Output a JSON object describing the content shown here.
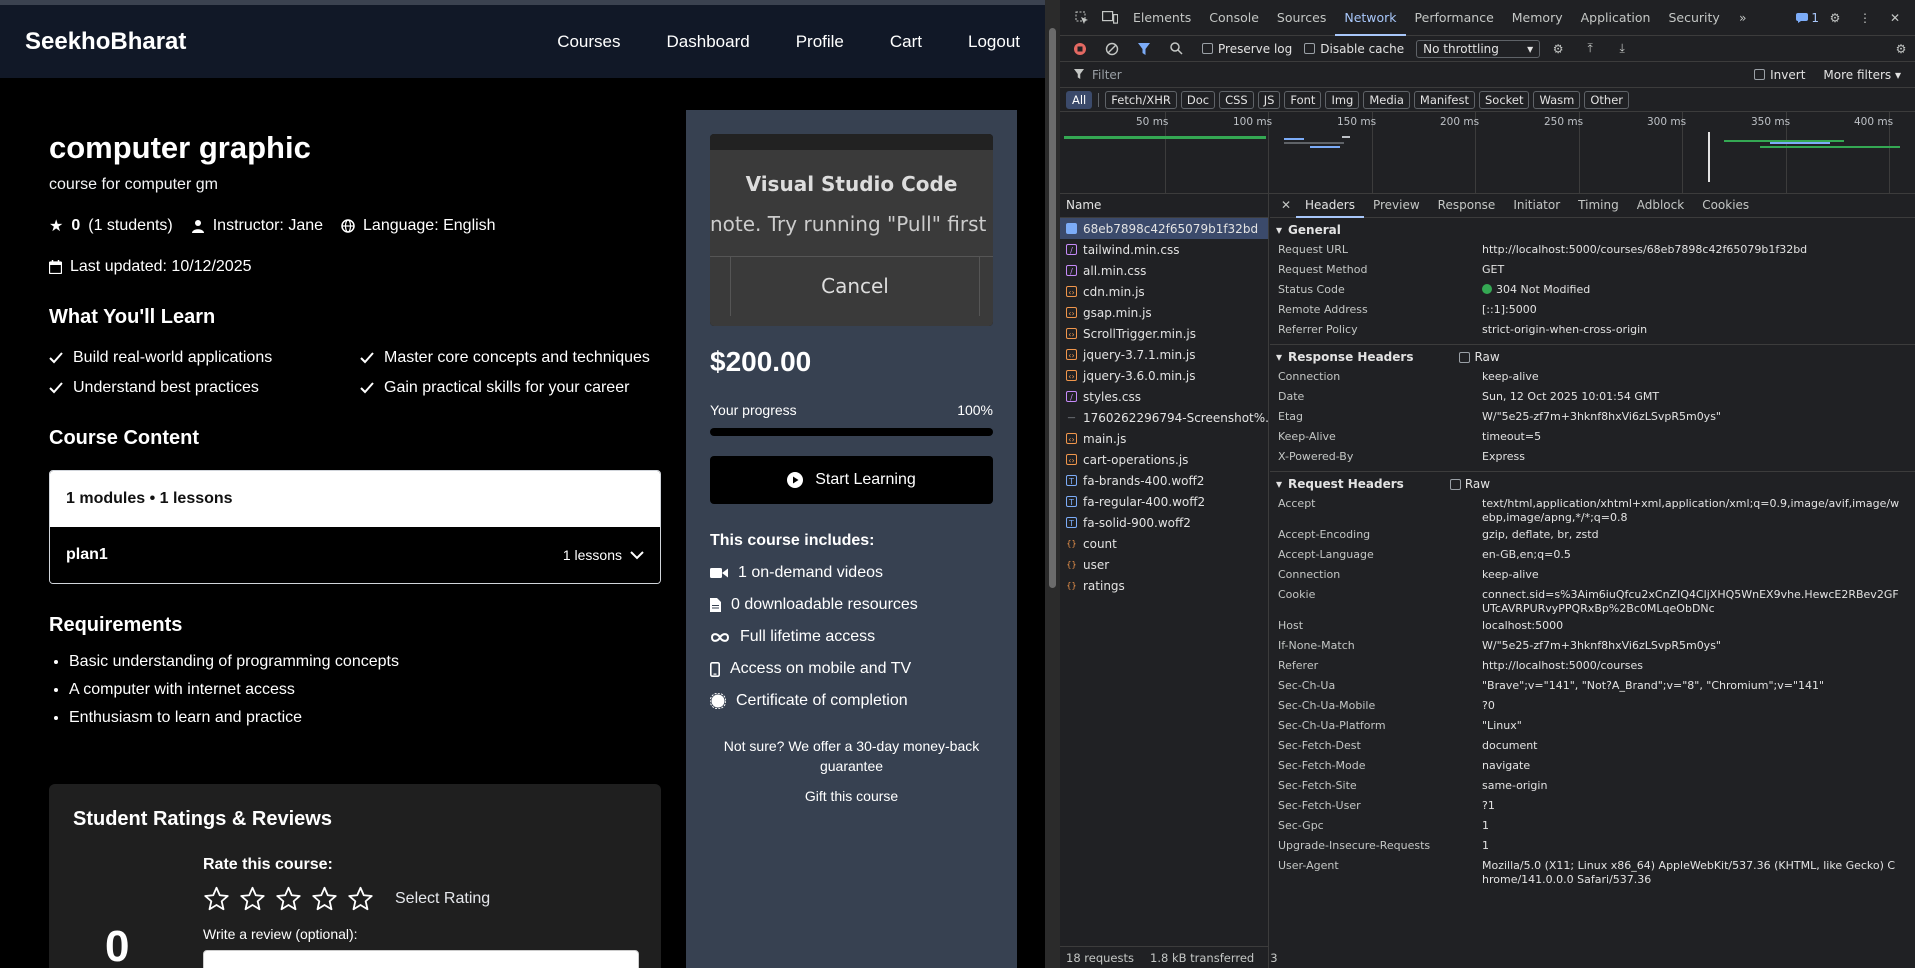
{
  "site": {
    "brand": "SeekhoBharat",
    "nav": [
      "Courses",
      "Dashboard",
      "Profile",
      "Cart",
      "Logout"
    ],
    "course": {
      "title": "computer graphic",
      "subtitle": "course for computer gm",
      "rating": "0",
      "students": "(1 students)",
      "instructor": "Instructor: Jane",
      "language": "Language: English",
      "last_updated": "Last updated: 10/12/2025"
    },
    "learn": {
      "heading": "What You'll Learn",
      "items": [
        "Build real-world applications",
        "Master core concepts and techniques",
        "Understand best practices",
        "Gain practical skills for your career"
      ]
    },
    "content": {
      "heading": "Course Content",
      "summary": "1 modules • 1 lessons",
      "module_name": "plan1",
      "module_lessons": "1 lessons"
    },
    "requirements": {
      "heading": "Requirements",
      "items": [
        "Basic understanding of programming concepts",
        "A computer with internet access",
        "Enthusiasm to learn and practice"
      ]
    },
    "reviews": {
      "heading": "Student Ratings & Reviews",
      "average": "0",
      "rate_title": "Rate this course:",
      "select_rating": "Select Rating",
      "write_label": "Write a review (optional):"
    },
    "sidebar": {
      "preview": {
        "title": "Visual Studio Code",
        "message": "note. Try running \"Pull\" first to in",
        "cancel": "Cancel"
      },
      "price": "$200.00",
      "progress_label": "Your progress",
      "progress_text": "100%",
      "progress_value": 1.0,
      "start_label": "Start Learning",
      "includes_title": "This course includes:",
      "includes": [
        "1 on-demand videos",
        "0 downloadable resources",
        "Full lifetime access",
        "Access on mobile and TV",
        "Certificate of completion"
      ],
      "money_back": "Not sure? We offer a 30-day money-back guarantee",
      "gift": "Gift this course"
    }
  },
  "devtools": {
    "tabs": [
      "Elements",
      "Console",
      "Sources",
      "Network",
      "Performance",
      "Memory",
      "Application",
      "Security"
    ],
    "active_tab": "Network",
    "issues_badge": "1",
    "toolbar": {
      "preserve_log": "Preserve log",
      "disable_cache": "Disable cache",
      "throttling": "No throttling"
    },
    "filter": {
      "placeholder": "Filter",
      "invert": "Invert",
      "more_filters": "More filters"
    },
    "types": [
      "All",
      "Fetch/XHR",
      "Doc",
      "CSS",
      "JS",
      "Font",
      "Img",
      "Media",
      "Manifest",
      "Socket",
      "Wasm",
      "Other"
    ],
    "timeline_ticks": [
      "50 ms",
      "100 ms",
      "150 ms",
      "200 ms",
      "250 ms",
      "300 ms",
      "350 ms",
      "400 ms"
    ],
    "name_header": "Name",
    "requests": [
      {
        "name": "68eb7898c42f65079b1f32bd",
        "kind": "doc"
      },
      {
        "name": "tailwind.min.css",
        "kind": "css"
      },
      {
        "name": "all.min.css",
        "kind": "css"
      },
      {
        "name": "cdn.min.js",
        "kind": "js"
      },
      {
        "name": "gsap.min.js",
        "kind": "js"
      },
      {
        "name": "ScrollTrigger.min.js",
        "kind": "js"
      },
      {
        "name": "jquery-3.7.1.min.js",
        "kind": "js"
      },
      {
        "name": "jquery-3.6.0.min.js",
        "kind": "js"
      },
      {
        "name": "styles.css",
        "kind": "css"
      },
      {
        "name": "1760262296794-Screenshot%...",
        "kind": "img"
      },
      {
        "name": "main.js",
        "kind": "js"
      },
      {
        "name": "cart-operations.js",
        "kind": "js"
      },
      {
        "name": "fa-brands-400.woff2",
        "kind": "font"
      },
      {
        "name": "fa-regular-400.woff2",
        "kind": "font"
      },
      {
        "name": "fa-solid-900.woff2",
        "kind": "font"
      },
      {
        "name": "count",
        "kind": "xhr"
      },
      {
        "name": "user",
        "kind": "xhr"
      },
      {
        "name": "ratings",
        "kind": "xhr"
      }
    ],
    "footer": {
      "requests": "18 requests",
      "transferred": "1.8 kB transferred",
      "trailing": "3"
    },
    "detail_tabs": [
      "Headers",
      "Preview",
      "Response",
      "Initiator",
      "Timing",
      "Adblock",
      "Cookies"
    ],
    "active_detail_tab": "Headers",
    "general": {
      "title": "General",
      "rows": [
        {
          "k": "Request URL",
          "v": "http://localhost:5000/courses/68eb7898c42f65079b1f32bd"
        },
        {
          "k": "Request Method",
          "v": "GET"
        },
        {
          "k": "Status Code",
          "v": "304 Not Modified"
        },
        {
          "k": "Remote Address",
          "v": "[::1]:5000"
        },
        {
          "k": "Referrer Policy",
          "v": "strict-origin-when-cross-origin"
        }
      ]
    },
    "response_headers": {
      "title": "Response Headers",
      "raw": "Raw",
      "rows": [
        {
          "k": "Connection",
          "v": "keep-alive"
        },
        {
          "k": "Date",
          "v": "Sun, 12 Oct 2025 10:01:54 GMT"
        },
        {
          "k": "Etag",
          "v": "W/\"5e25-zf7m+3hknf8hxVi6zLSvpR5m0ys\""
        },
        {
          "k": "Keep-Alive",
          "v": "timeout=5"
        },
        {
          "k": "X-Powered-By",
          "v": "Express"
        }
      ]
    },
    "request_headers": {
      "title": "Request Headers",
      "raw": "Raw",
      "rows": [
        {
          "k": "Accept",
          "v": "text/html,application/xhtml+xml,application/xml;q=0.9,image/avif,image/webp,image/apng,*/*;q=0.8"
        },
        {
          "k": "Accept-Encoding",
          "v": "gzip, deflate, br, zstd"
        },
        {
          "k": "Accept-Language",
          "v": "en-GB,en;q=0.5"
        },
        {
          "k": "Connection",
          "v": "keep-alive"
        },
        {
          "k": "Cookie",
          "v": "connect.sid=s%3Aim6iuQfcu2xCnZIQ4CljXHQ5WnEX9vhe.HewcE2RBev2GFUTcAVRPURvyPPQRxBp%2Bc0MLqeObDNc"
        },
        {
          "k": "Host",
          "v": "localhost:5000"
        },
        {
          "k": "If-None-Match",
          "v": "W/\"5e25-zf7m+3hknf8hxVi6zLSvpR5m0ys\""
        },
        {
          "k": "Referer",
          "v": "http://localhost:5000/courses"
        },
        {
          "k": "Sec-Ch-Ua",
          "v": "\"Brave\";v=\"141\", \"Not?A_Brand\";v=\"8\", \"Chromium\";v=\"141\""
        },
        {
          "k": "Sec-Ch-Ua-Mobile",
          "v": "?0"
        },
        {
          "k": "Sec-Ch-Ua-Platform",
          "v": "\"Linux\""
        },
        {
          "k": "Sec-Fetch-Dest",
          "v": "document"
        },
        {
          "k": "Sec-Fetch-Mode",
          "v": "navigate"
        },
        {
          "k": "Sec-Fetch-Site",
          "v": "same-origin"
        },
        {
          "k": "Sec-Fetch-User",
          "v": "?1"
        },
        {
          "k": "Sec-Gpc",
          "v": "1"
        },
        {
          "k": "Upgrade-Insecure-Requests",
          "v": "1"
        },
        {
          "k": "User-Agent",
          "v": "Mozilla/5.0 (X11; Linux x86_64) AppleWebKit/537.36 (KHTML, like Gecko) Chrome/141.0.0.0 Safari/537.36"
        }
      ]
    },
    "colors": {
      "status_ok": "#34a853",
      "accent": "#a8c7fa",
      "selected_row": "#3b4a6b",
      "record_red": "#e46962"
    }
  }
}
